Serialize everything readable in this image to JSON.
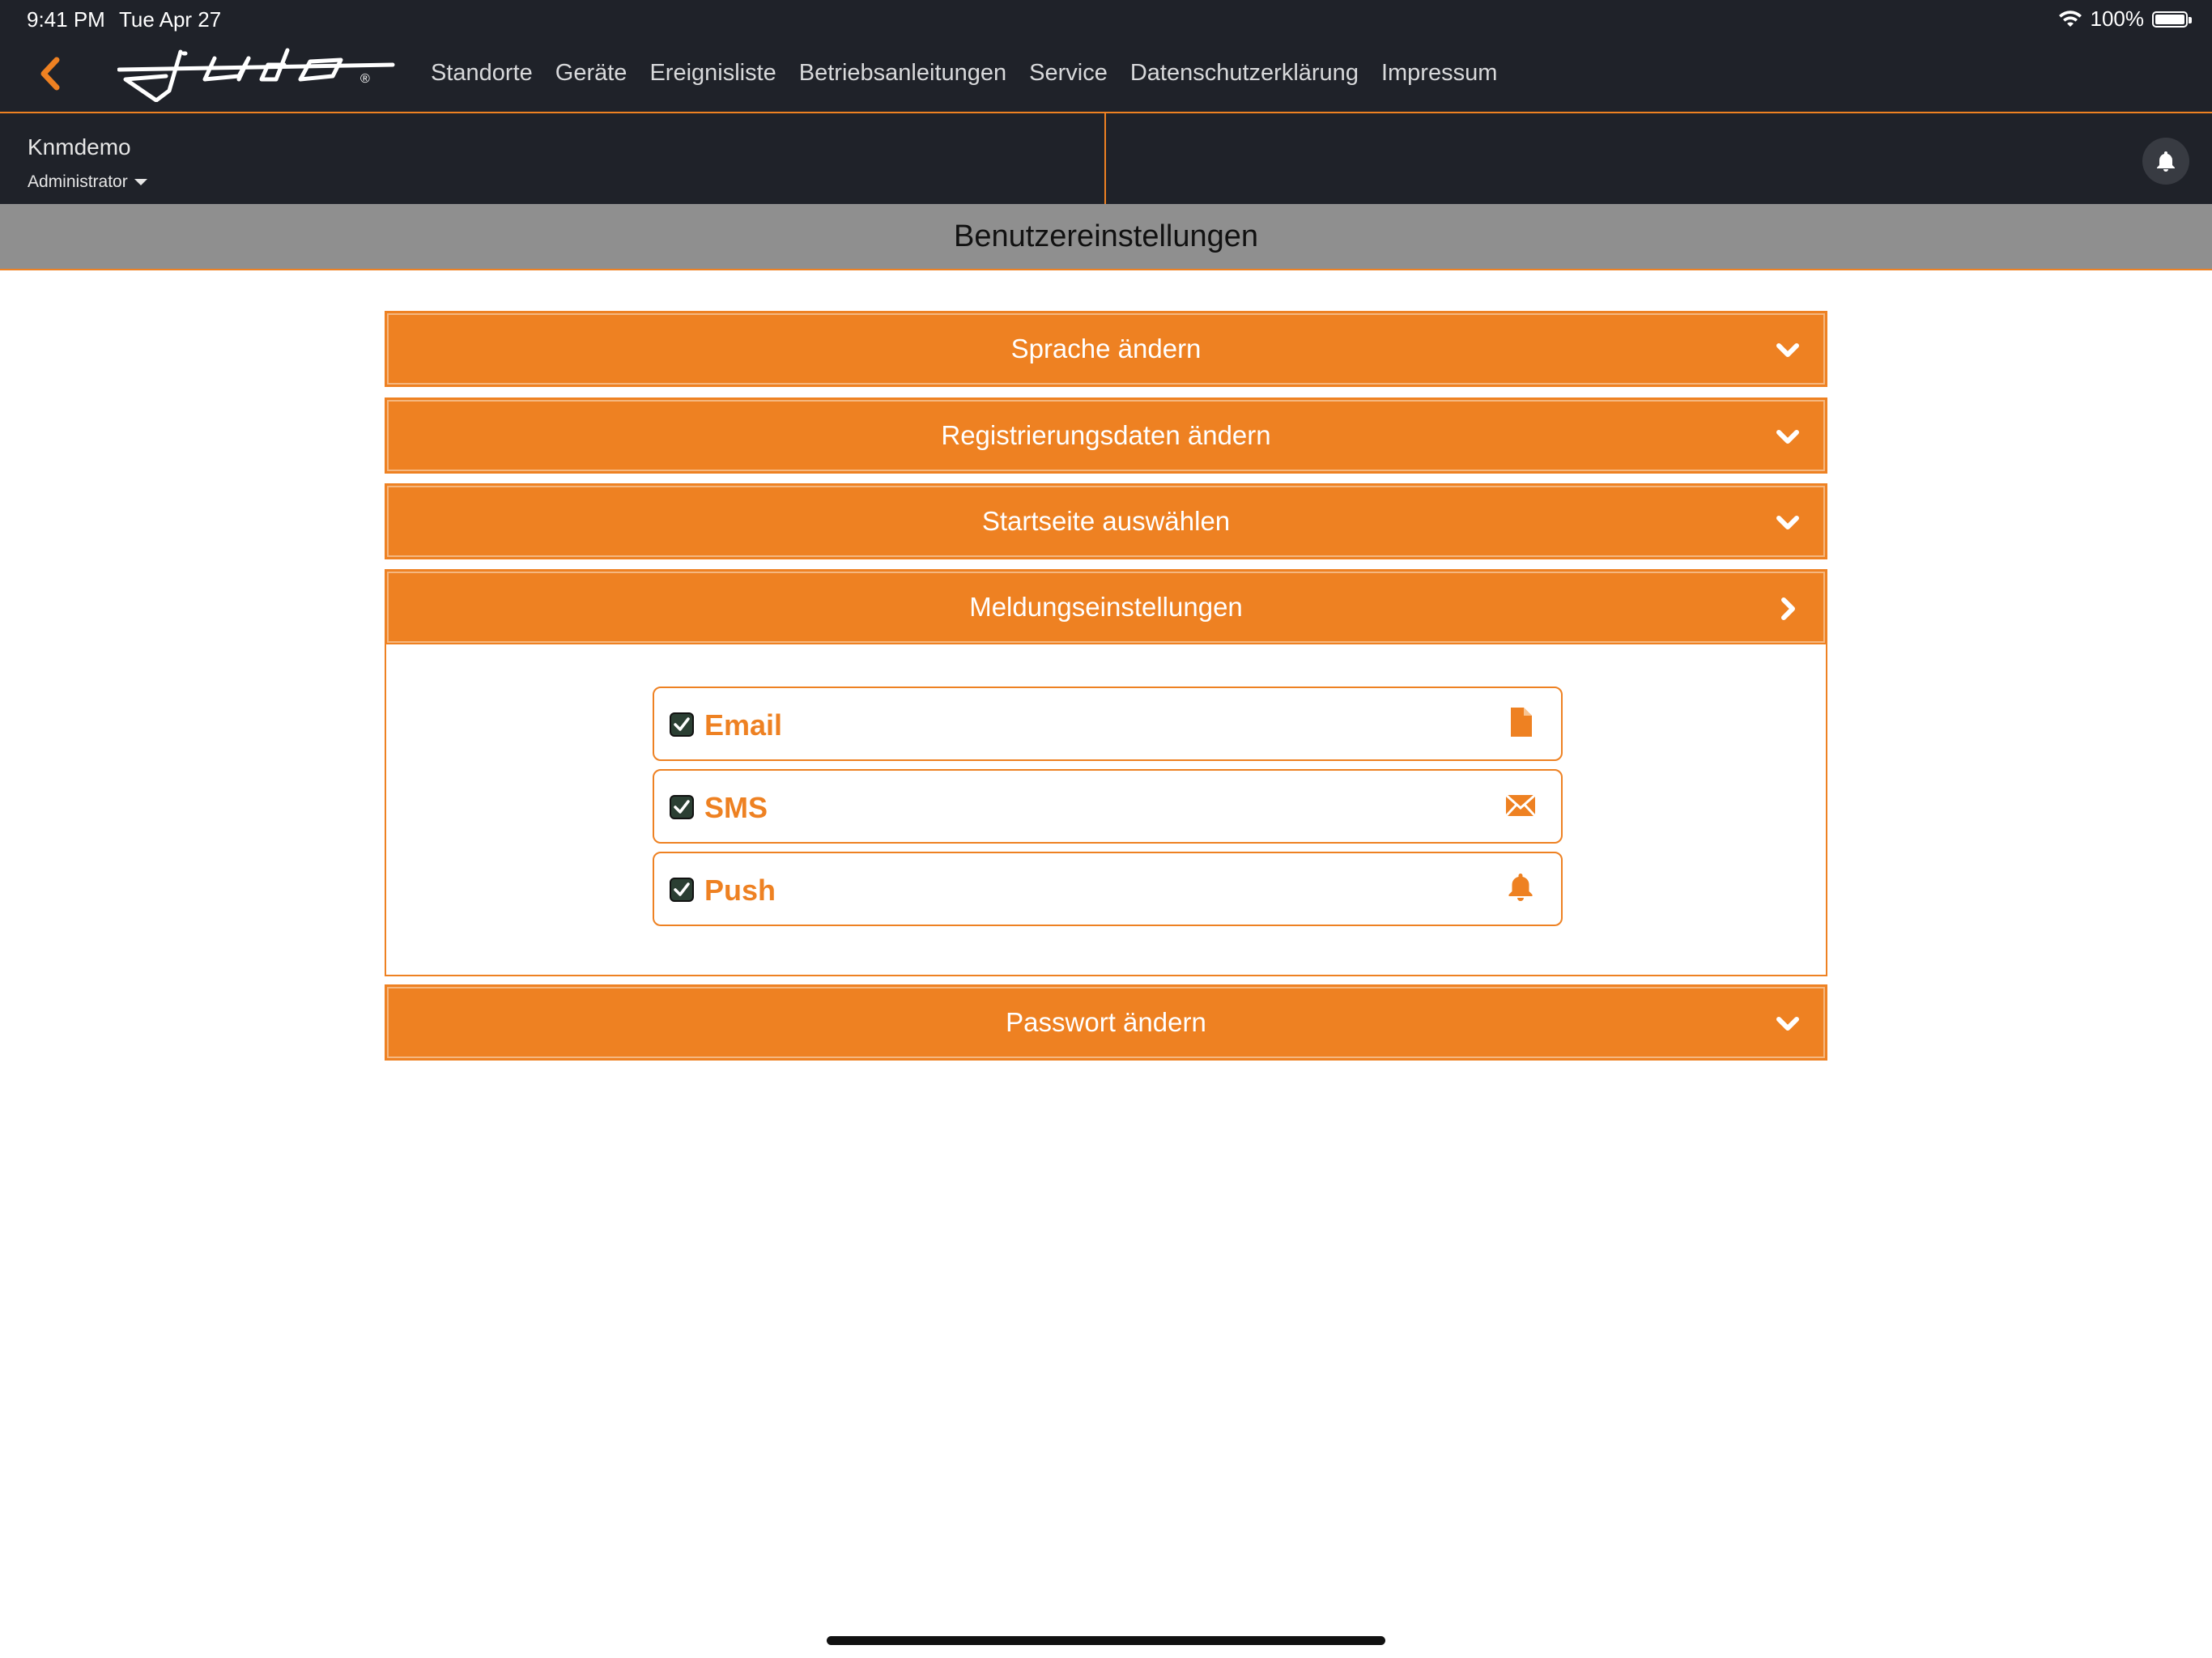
{
  "status_bar": {
    "time": "9:41 PM",
    "date": "Tue Apr 27",
    "battery": "100%"
  },
  "nav": {
    "logo_icon": "judo-logo",
    "back_icon": "chevron-left-icon",
    "links": [
      "Standorte",
      "Geräte",
      "Ereignisliste",
      "Betriebsanleitungen",
      "Service",
      "Datenschutzerklärung",
      "Impressum"
    ]
  },
  "user": {
    "name": "Knmdemo",
    "role": "Administrator"
  },
  "page_title": "Benutzereinstellungen",
  "sections": [
    {
      "label": "Sprache ändern",
      "expanded": false
    },
    {
      "label": "Registrierungsdaten ändern",
      "expanded": false
    },
    {
      "label": "Startseite auswählen",
      "expanded": false
    },
    {
      "label": "Meldungseinstellungen",
      "expanded": true
    },
    {
      "label": "Passwort ändern",
      "expanded": false
    }
  ],
  "notification_channels": [
    {
      "label": "Email",
      "checked": true,
      "icon": "document-icon"
    },
    {
      "label": "SMS",
      "checked": true,
      "icon": "envelope-icon"
    },
    {
      "label": "Push",
      "checked": true,
      "icon": "bell-icon"
    }
  ],
  "colors": {
    "accent": "#ee8122",
    "dark_bg": "#1f2229",
    "title_bar": "#8f8f8f"
  }
}
